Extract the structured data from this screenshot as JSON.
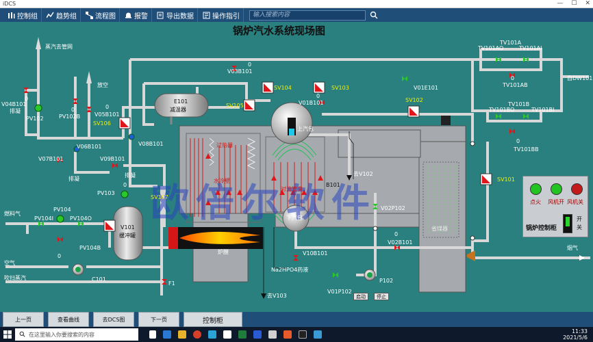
{
  "window": {
    "title": "iDCS",
    "minimize": "—",
    "maximize": "☐",
    "close": "✕"
  },
  "toolbar": {
    "items": [
      {
        "label": "控制组",
        "icon": "control-group-icon"
      },
      {
        "label": "趋势组",
        "icon": "trend-icon"
      },
      {
        "label": "流程图",
        "icon": "flow-chart-icon"
      },
      {
        "label": "报警",
        "icon": "alarm-icon"
      },
      {
        "label": "导出数据",
        "icon": "export-icon"
      },
      {
        "label": "操作指引",
        "icon": "guide-icon"
      }
    ],
    "search_placeholder": "输入搜索内容"
  },
  "diagram": {
    "title": "锅炉汽水系统现场图",
    "watermark": "欧倍尔软件",
    "labels": {
      "steam_out": "蒸汽去管网",
      "vent": "放空",
      "drain1": "排凝",
      "drain2": "排凝",
      "drain3": "排凝",
      "fuel_gas": "燃料气",
      "air": "空气",
      "purge_steam": "吹扫蒸汽",
      "flue_gas": "烟气",
      "from_dw101": "自DW101",
      "to_v102": "去V102",
      "to_v103": "去V103",
      "na2hpo4": "Na2HPO4药液",
      "tank_v101": "V101",
      "tank_v101_name": "缓冲罐",
      "e101": "E101",
      "e101_name": "减温器",
      "b101": "B101",
      "upper_drum": "上汽包",
      "lower_drum": "下汽包",
      "furnace": "炉膛",
      "economizer": "省煤器",
      "water_wall": "水冷壁",
      "convection": "对流管束",
      "superheater": "过热器",
      "p102": "P102",
      "c101": "C101",
      "f1": "F1",
      "start": "启动",
      "stop": "停止"
    },
    "tags": {
      "v04b101": "V04B101",
      "pv102": "PV102",
      "pv102b": "PV102B",
      "sv106": "SV106",
      "v05b101": "V05B101",
      "v06b101": "V06B101",
      "v07b101": "V07B101",
      "v08b101": "V08B101",
      "v09b101": "V09B101",
      "v03b101": "V03B101",
      "sv104": "SV104",
      "sv103": "SV103",
      "sv105": "SV105",
      "v01b101": "V01B101",
      "sv102": "SV102",
      "v01e101": "V01E101",
      "tv101a": "TV101A",
      "tv101ao": "TV101AO",
      "tv101ai": "TV101AI",
      "tv101ab": "TV101AB",
      "tv101b": "TV101B",
      "tv101bo": "TV101BO",
      "tv101bi": "TV101BI",
      "tv101bb": "TV101BB",
      "sv101": "SV101",
      "pv103": "PV103",
      "sv107": "SV107",
      "pv104": "PV104",
      "pv104i": "PV104I",
      "pv104o": "PV104O",
      "pv104b": "PV104B",
      "v02p102": "V02P102",
      "v02b101": "V02B101",
      "v10b101": "V10B101",
      "v01p102": "V01P102"
    },
    "values": {
      "pv102b": "0",
      "v05b101": "0",
      "v03b101": "0",
      "v01b101": "0",
      "tv101ab": "0",
      "tv101bb": "0",
      "pv104b": "0",
      "v02b101": "0",
      "v04b101": "0",
      "pv103": "0"
    }
  },
  "control_panel": {
    "title": "锅炉控制柜",
    "lamp_ignite": "点火",
    "lamp_fan_on": "风机开",
    "lamp_fan_off": "风机关",
    "switch_label": "开关",
    "colors": {
      "on": "#22c422",
      "off": "#c41a1a"
    }
  },
  "nav": {
    "prev": "上一页",
    "trend": "查看曲线",
    "to_dcs": "去DCS图",
    "next": "下一页",
    "control_cabinet": "控制柜"
  },
  "taskbar": {
    "search_placeholder": "在这里输入你要搜索的内容",
    "time": "11:33",
    "date": "2021/5/6"
  }
}
